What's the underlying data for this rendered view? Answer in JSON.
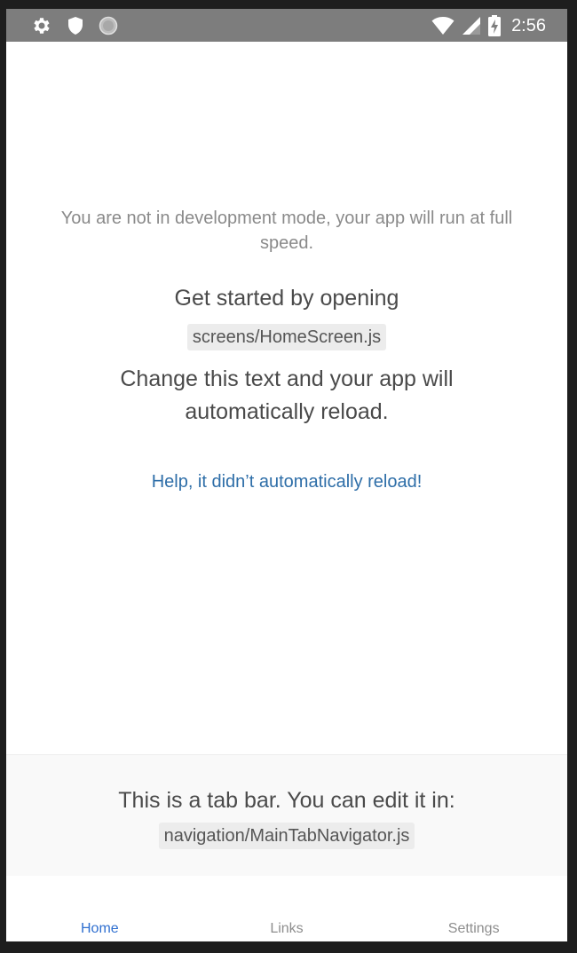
{
  "status_bar": {
    "time": "2:56",
    "left_icons": [
      "gear-icon",
      "shield-icon",
      "circle-dots-icon"
    ],
    "right_icons": [
      "wifi-icon",
      "signal-icon",
      "battery-charging-icon"
    ]
  },
  "main": {
    "dev_notice": "You are not in development mode, your app will run at full speed.",
    "get_started": "Get started by opening",
    "file_path": "screens/HomeScreen.js",
    "change_text": "Change this text and your app will automatically reload.",
    "help_link": "Help, it didn’t automatically reload!"
  },
  "tabbar_info": {
    "text": "This is a tab bar. You can edit it in:",
    "file_path": "navigation/MainTabNavigator.js"
  },
  "tabs": [
    {
      "label": "Home",
      "active": true
    },
    {
      "label": "Links",
      "active": false
    },
    {
      "label": "Settings",
      "active": false
    }
  ],
  "colors": {
    "status_bar": "#7d7d7d",
    "link": "#2e6ea8",
    "active_tab": "#2f6fd0",
    "inactive_tab": "#8e8e8e"
  }
}
